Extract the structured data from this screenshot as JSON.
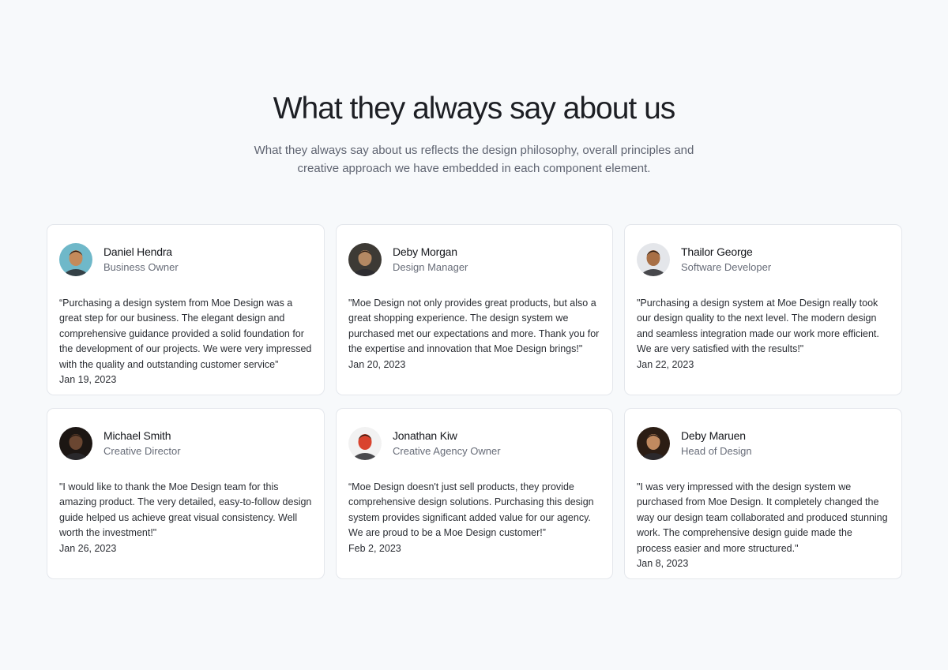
{
  "section": {
    "title": "What they always say about us",
    "subtitle": "What they always say about us reflects the design philosophy, overall principles and creative approach we have embedded in each component element."
  },
  "testimonials": [
    {
      "name": "Daniel Hendra",
      "role": "Business Owner",
      "quote": "“Purchasing a design system from Moe Design was a great step for our business. The elegant design and comprehensive guidance provided a solid foundation for the development of our projects. We were very impressed with the quality and outstanding customer service”",
      "date": "Jan 19, 2023",
      "avatar_icon": "avatar-photo-daniel",
      "avatar_colors": [
        "#6fb8c9",
        "#c48a5a"
      ]
    },
    {
      "name": "Deby Morgan",
      "role": "Design Manager",
      "quote": "\"Moe Design not only provides great products, but also a great shopping experience. The design system we purchased met our expectations and more. Thank you for the expertise and innovation that Moe Design brings!\"",
      "date": "Jan 20, 2023",
      "avatar_icon": "avatar-photo-deby-morgan",
      "avatar_colors": [
        "#3d3a35",
        "#b48963"
      ]
    },
    {
      "name": "Thailor George",
      "role": "Software Developer",
      "quote": "\"Purchasing a design system at Moe Design really took our design quality to the next level. The modern design and seamless integration made our work more efficient. We are very satisfied with the results!\"",
      "date": "Jan 22, 2023",
      "avatar_icon": "avatar-photo-thailor",
      "avatar_colors": [
        "#e4e6ea",
        "#a86f45"
      ]
    },
    {
      "name": "Michael Smith",
      "role": "Creative Director",
      "quote": "\"I would like to thank the Moe Design team for this amazing product. The very detailed, easy-to-follow design guide helped us achieve great visual consistency. Well worth the investment!\"",
      "date": "Jan 26, 2023",
      "avatar_icon": "avatar-photo-michael",
      "avatar_colors": [
        "#1c1613",
        "#6a4631"
      ]
    },
    {
      "name": "Jonathan Kiw",
      "role": "Creative Agency Owner",
      "quote": "“Moe Design doesn't just sell products, they provide comprehensive design solutions. Purchasing this design system provides significant added value for our agency. We are proud to be a Moe Design customer!”",
      "date": "Feb 2, 2023",
      "avatar_icon": "avatar-photo-jonathan",
      "avatar_colors": [
        "#f2f2f2",
        "#d9432e"
      ]
    },
    {
      "name": "Deby Maruen",
      "role": "Head of Design",
      "quote": "\"I was very impressed with the design system we purchased from Moe Design. It completely changed the way our design team collaborated and produced stunning work. The comprehensive design guide made the process easier and more structured.\"",
      "date": "Jan 8, 2023",
      "avatar_icon": "avatar-photo-deby-maruen",
      "avatar_colors": [
        "#2b1d14",
        "#c08a60"
      ]
    }
  ]
}
